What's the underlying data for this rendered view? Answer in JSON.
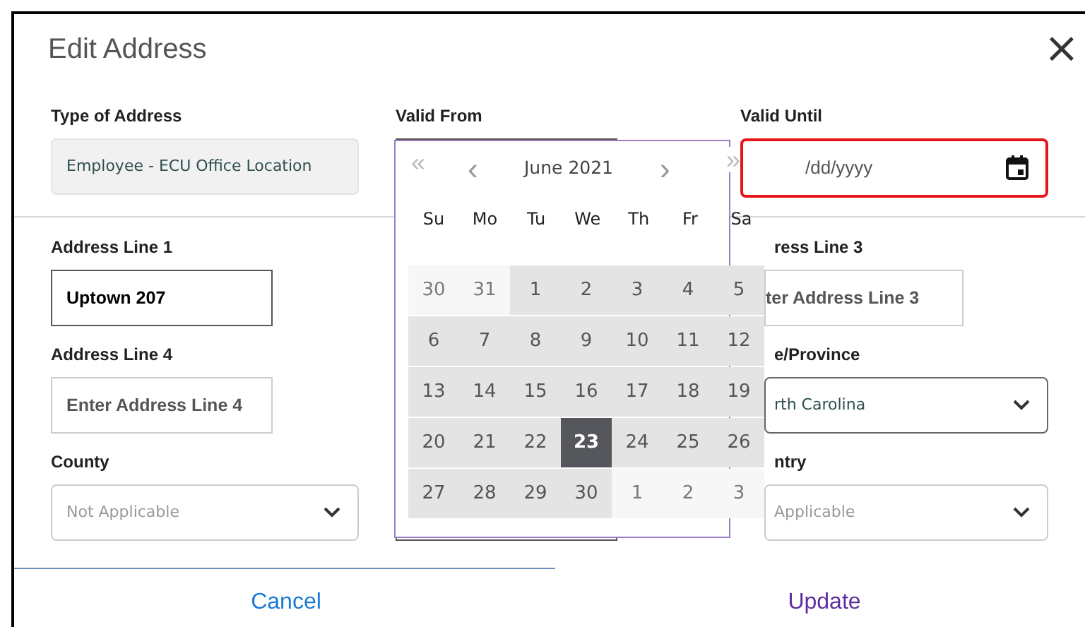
{
  "dialog": {
    "title": "Edit Address",
    "close": "×"
  },
  "fields": [
    {
      "label": "Type of Address",
      "kind": "readonly",
      "value": "Employee - ECU Office Location"
    },
    {
      "label": "Valid From",
      "kind": "hidden"
    },
    {
      "label": "Valid Until",
      "kind": "date",
      "placeholder": "/dd/yyyy",
      "focused": true
    },
    {
      "label": "Address Line 1",
      "kind": "text",
      "value": "Uptown 207"
    },
    {
      "kind": "hidden"
    },
    {
      "label": "ress Line 3",
      "kind": "text",
      "placeholder": "ter Address Line 3"
    },
    {
      "label": "Address Line 4",
      "kind": "text",
      "placeholder": "Enter Address Line 4"
    },
    {
      "kind": "hidden"
    },
    {
      "label": "e/Province",
      "kind": "select",
      "value": "rth Carolina",
      "dark_border": true
    },
    {
      "label": "County",
      "kind": "select",
      "placeholder": "Not Applicable"
    },
    {
      "kind": "hidden"
    },
    {
      "label": "ntry",
      "kind": "select",
      "placeholder": "Applicable"
    }
  ],
  "calendar": {
    "first": "«",
    "prev": "‹",
    "month": "June 2021",
    "next": "›",
    "last": "»",
    "weekdays": [
      "Su",
      "Mo",
      "Tu",
      "We",
      "Th",
      "Fr",
      "Sa"
    ],
    "days": [
      {
        "label": "30",
        "other_month": true,
        "selected": false
      },
      {
        "label": "31",
        "other_month": true,
        "selected": false
      },
      {
        "label": "1",
        "other_month": false,
        "selected": false
      },
      {
        "label": "2",
        "other_month": false,
        "selected": false
      },
      {
        "label": "3",
        "other_month": false,
        "selected": false
      },
      {
        "label": "4",
        "other_month": false,
        "selected": false
      },
      {
        "label": "5",
        "other_month": false,
        "selected": false
      },
      {
        "label": "6",
        "other_month": false,
        "selected": false
      },
      {
        "label": "7",
        "other_month": false,
        "selected": false
      },
      {
        "label": "8",
        "other_month": false,
        "selected": false
      },
      {
        "label": "9",
        "other_month": false,
        "selected": false
      },
      {
        "label": "10",
        "other_month": false,
        "selected": false
      },
      {
        "label": "11",
        "other_month": false,
        "selected": false
      },
      {
        "label": "12",
        "other_month": false,
        "selected": false
      },
      {
        "label": "13",
        "other_month": false,
        "selected": false
      },
      {
        "label": "14",
        "other_month": false,
        "selected": false
      },
      {
        "label": "15",
        "other_month": false,
        "selected": false
      },
      {
        "label": "16",
        "other_month": false,
        "selected": false
      },
      {
        "label": "17",
        "other_month": false,
        "selected": false
      },
      {
        "label": "18",
        "other_month": false,
        "selected": false
      },
      {
        "label": "19",
        "other_month": false,
        "selected": false
      },
      {
        "label": "20",
        "other_month": false,
        "selected": false
      },
      {
        "label": "21",
        "other_month": false,
        "selected": false
      },
      {
        "label": "22",
        "other_month": false,
        "selected": false
      },
      {
        "label": "23",
        "other_month": false,
        "selected": true
      },
      {
        "label": "24",
        "other_month": false,
        "selected": false
      },
      {
        "label": "25",
        "other_month": false,
        "selected": false
      },
      {
        "label": "26",
        "other_month": false,
        "selected": false
      },
      {
        "label": "27",
        "other_month": false,
        "selected": false
      },
      {
        "label": "28",
        "other_month": false,
        "selected": false
      },
      {
        "label": "29",
        "other_month": false,
        "selected": false
      },
      {
        "label": "30",
        "other_month": false,
        "selected": false
      },
      {
        "label": "1",
        "other_month": true,
        "selected": false
      },
      {
        "label": "2",
        "other_month": true,
        "selected": false
      },
      {
        "label": "3",
        "other_month": true,
        "selected": false
      }
    ]
  },
  "buttons": [
    {
      "label": "Cancel",
      "kind": "cancel"
    },
    {
      "label": "Update",
      "kind": "update"
    }
  ]
}
